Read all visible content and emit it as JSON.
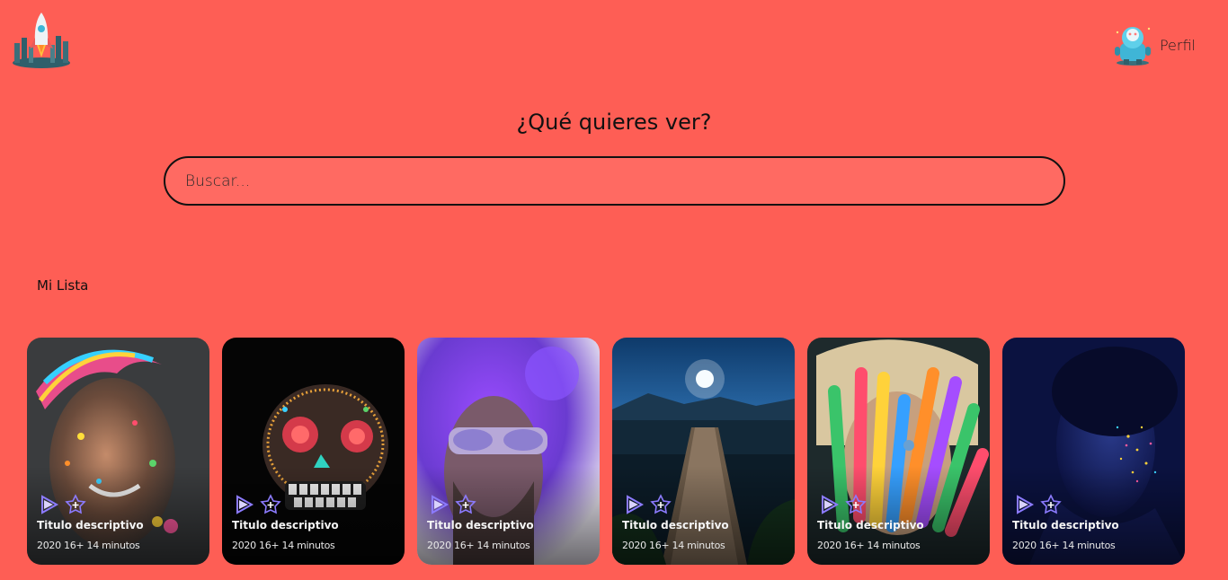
{
  "header": {
    "logo_icon": "rocket-logo-icon",
    "profile_label": "Perfil",
    "profile_icon": "robot-avatar-icon"
  },
  "hero": {
    "title": "¿Qué quieres ver?",
    "search_placeholder": "Buscar..."
  },
  "section": {
    "title": "Mi Lista"
  },
  "cards": [
    {
      "title": "Titulo descriptivo",
      "meta": "2020 16+ 14 minutos",
      "play_icon": "play-icon",
      "add_icon": "add-to-list-icon"
    },
    {
      "title": "Titulo descriptivo",
      "meta": "2020 16+ 14 minutos",
      "play_icon": "play-icon",
      "add_icon": "add-to-list-icon"
    },
    {
      "title": "Titulo descriptivo",
      "meta": "2020 16+ 14 minutos",
      "play_icon": "play-icon",
      "add_icon": "add-to-list-icon"
    },
    {
      "title": "Titulo descriptivo",
      "meta": "2020 16+ 14 minutos",
      "play_icon": "play-icon",
      "add_icon": "add-to-list-icon"
    },
    {
      "title": "Titulo descriptivo",
      "meta": "2020 16+ 14 minutos",
      "play_icon": "play-icon",
      "add_icon": "add-to-list-icon"
    },
    {
      "title": "Titulo descriptivo",
      "meta": "2020 16+ 14 minutos",
      "play_icon": "play-icon",
      "add_icon": "add-to-list-icon"
    }
  ],
  "colors": {
    "background": "#fe5e55",
    "search_fill": "#ff6a62",
    "icon_accent": "#7b5cff"
  }
}
